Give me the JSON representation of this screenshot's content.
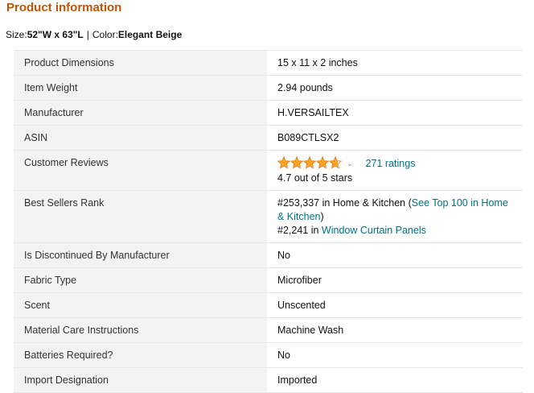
{
  "section_title": "Product information",
  "variation": {
    "size_label": "Size:",
    "size_value": "52\"W x 63\"L",
    "separator": "|",
    "color_label": "Color:",
    "color_value": "Elegant Beige"
  },
  "rows": {
    "dimensions": {
      "label": "Product Dimensions",
      "value": "15 x 11 x 2 inches"
    },
    "weight": {
      "label": "Item Weight",
      "value": "2.94 pounds"
    },
    "manufacturer": {
      "label": "Manufacturer",
      "value": "H.VERSAILTEX"
    },
    "asin": {
      "label": "ASIN",
      "value": "B089CTLSX2"
    },
    "reviews": {
      "label": "Customer Reviews",
      "rating": 4.7,
      "ratings_link": "271 ratings",
      "rating_text": "4.7 out of 5 stars"
    },
    "bsr": {
      "label": "Best Sellers Rank",
      "line1_rank": "#253,337 in Home & Kitchen (",
      "line1_link": "See Top 100 in Home & Kitchen",
      "line1_close": ")",
      "line2_rank": "#2,241 in ",
      "line2_link": "Window Curtain Panels"
    },
    "discontinued": {
      "label": "Is Discontinued By Manufacturer",
      "value": "No"
    },
    "fabric": {
      "label": "Fabric Type",
      "value": "Microfiber"
    },
    "scent": {
      "label": "Scent",
      "value": "Unscented"
    },
    "care": {
      "label": "Material Care Instructions",
      "value": "Machine Wash"
    },
    "batteries": {
      "label": "Batteries Required?",
      "value": "No"
    },
    "import": {
      "label": "Import Designation",
      "value": "Imported"
    }
  },
  "colors": {
    "title": "#c45500",
    "link": "#007185",
    "star": "#ffa41c",
    "label_bg": "#f3f3f3"
  },
  "icons": {
    "star": "star-icon",
    "dropdown": "chevron-down-icon"
  }
}
